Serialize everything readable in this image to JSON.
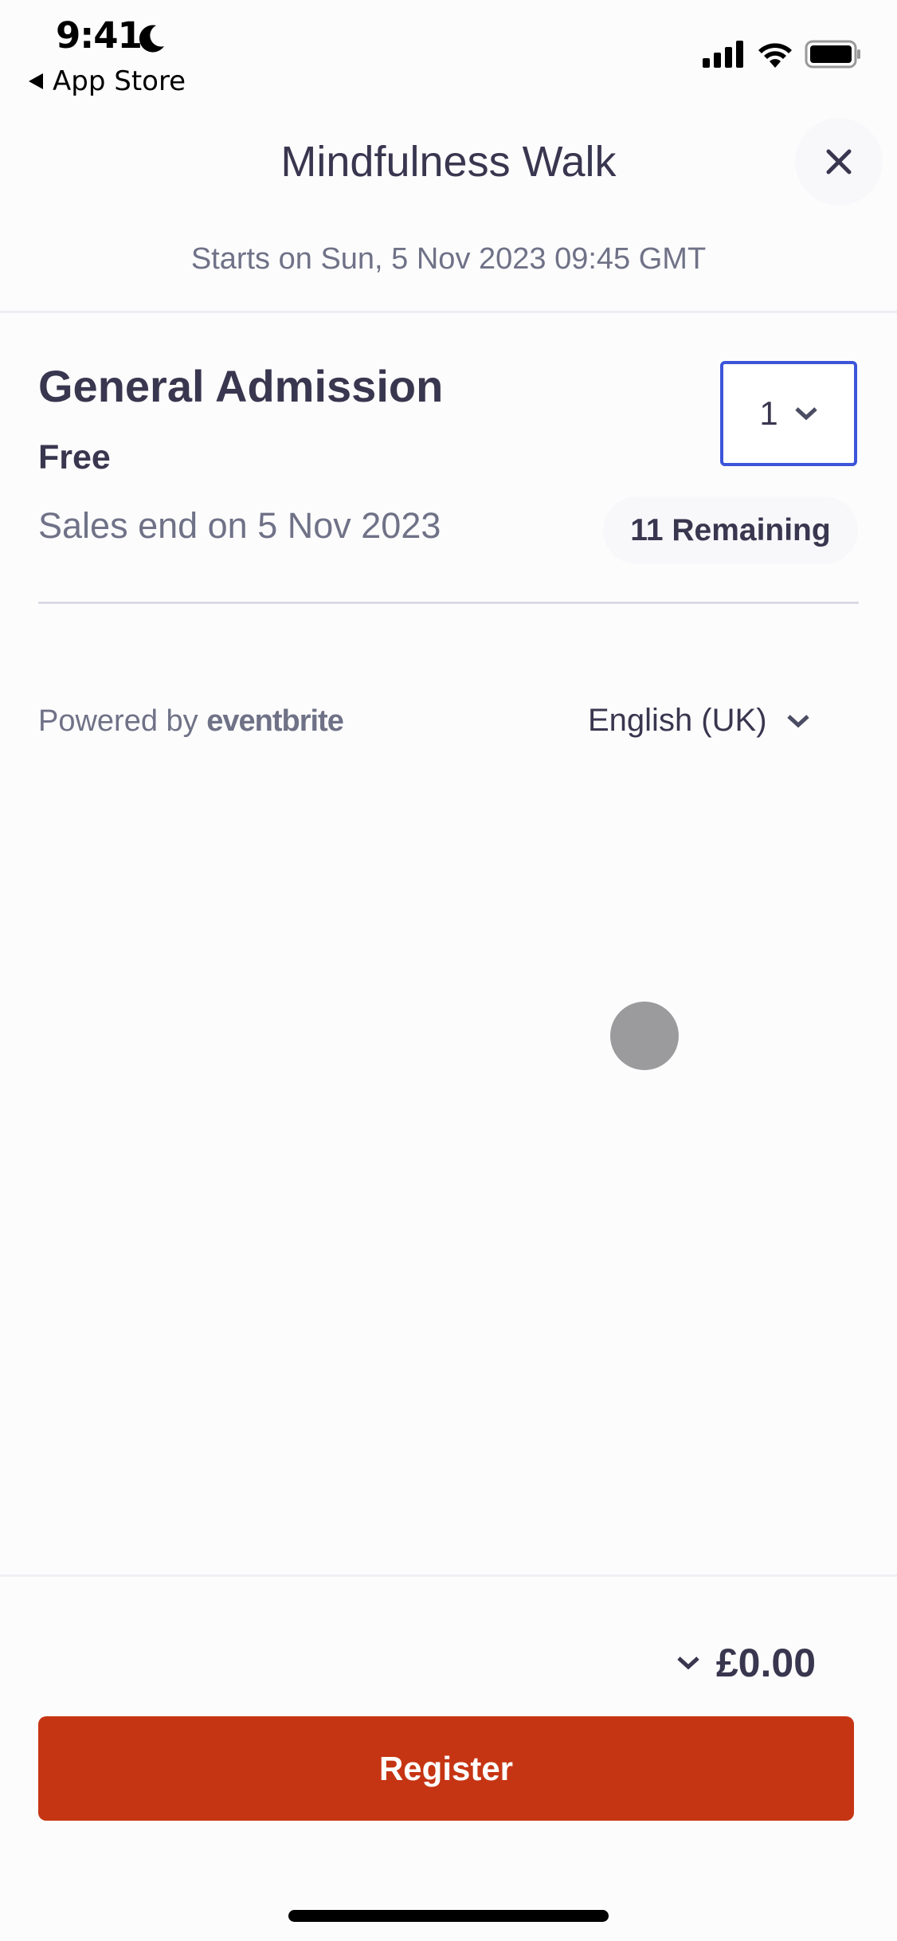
{
  "status_bar": {
    "time": "9:41",
    "back_label": "App Store",
    "icons": [
      "moon-icon",
      "signal-icon",
      "wifi-icon",
      "battery-icon"
    ]
  },
  "header": {
    "title": "Mindfulness Walk",
    "subtitle": "Starts on Sun, 5 Nov 2023 09:45 GMT",
    "close_icon": "close-icon"
  },
  "ticket": {
    "name": "General Admission",
    "price": "Free",
    "sales_end": "Sales end on 5 Nov 2023",
    "quantity": "1",
    "remaining": "11 Remaining"
  },
  "footer_links": {
    "powered_by": "Powered by",
    "brand": "eventbrite",
    "language": "English (UK)"
  },
  "checkout": {
    "total": "£0.00",
    "register_label": "Register"
  },
  "colors": {
    "accent": "#3d55d8",
    "primary_button": "#c63513",
    "text": "#39364f",
    "muted_text": "#6f7287"
  }
}
